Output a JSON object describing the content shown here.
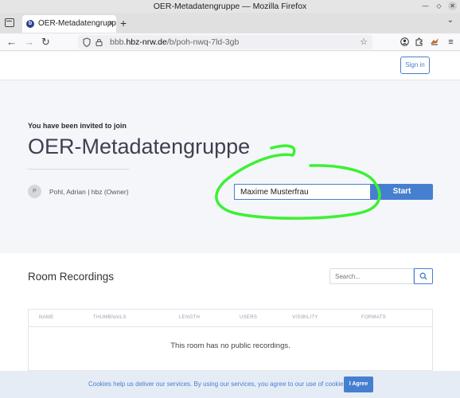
{
  "window": {
    "title": "OER-Metadatengruppe — Mozilla Firefox"
  },
  "tab": {
    "title": "OER-Metadatengruppe",
    "close": "×",
    "favicon_letter": "b"
  },
  "toolbar": {
    "new_tab": "+",
    "back": "←",
    "forward": "→",
    "reload": "↻",
    "star": "☆"
  },
  "url": {
    "prefix": "bbb.",
    "host": "hbz-nrw.de",
    "path": "/b/poh-nwq-7ld-3gb"
  },
  "header": {
    "signin_label": "Sign in"
  },
  "hero": {
    "invited_text": "You have been invited to join",
    "room_title": "OER-Metadatengruppe",
    "owner_initial": "P",
    "owner_name": "Pohl, Adrian | hbz (Owner)",
    "name_value": "Maxime Musterfrau",
    "start_label": "Start"
  },
  "recordings": {
    "title": "Room Recordings",
    "search_placeholder": "Search...",
    "columns": [
      "NAME",
      "THUMBNAILS",
      "LENGTH",
      "USERS",
      "VISIBILITY",
      "FORMATS"
    ],
    "empty_text": "This room has no public recordings."
  },
  "cookies": {
    "text": "Cookies help us deliver our services. By using our services, you agree to our use of cookies.",
    "button_label": "I Agree"
  },
  "colors": {
    "accent": "#467fcf",
    "annotation": "#3ef034"
  },
  "annotation": {
    "type": "green-freehand-circle",
    "target": "name-input"
  }
}
